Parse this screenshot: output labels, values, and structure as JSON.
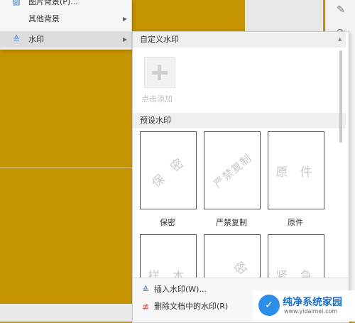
{
  "menu": {
    "items": [
      {
        "label": "图片背景(P)...",
        "icon": "image-icon"
      },
      {
        "label": "其他背景",
        "icon": "",
        "has_arrow": true
      },
      {
        "label": "水印",
        "icon": "watermark-icon",
        "has_arrow": true,
        "active": true
      }
    ]
  },
  "submenu": {
    "custom_title": "自定义水印",
    "add_label": "点击添加",
    "preset_title": "预设水印",
    "presets": [
      {
        "text": "保 密",
        "caption": "保密"
      },
      {
        "text": "严禁复制",
        "caption": "严禁复制"
      },
      {
        "text": "原 件",
        "caption": "原件"
      },
      {
        "text": "样 本",
        "caption": ""
      },
      {
        "text": "绝 密",
        "caption": ""
      },
      {
        "text": "紧 急",
        "caption": ""
      }
    ],
    "insert_label": "插入水印(W)...",
    "delete_label": "删除文档中的水印(R)"
  },
  "logo": {
    "name": "纯净系统家园",
    "url": "www.yidaimei.com"
  },
  "colors": {
    "document_bg": "#c39300",
    "accent": "#4a7fc1"
  }
}
